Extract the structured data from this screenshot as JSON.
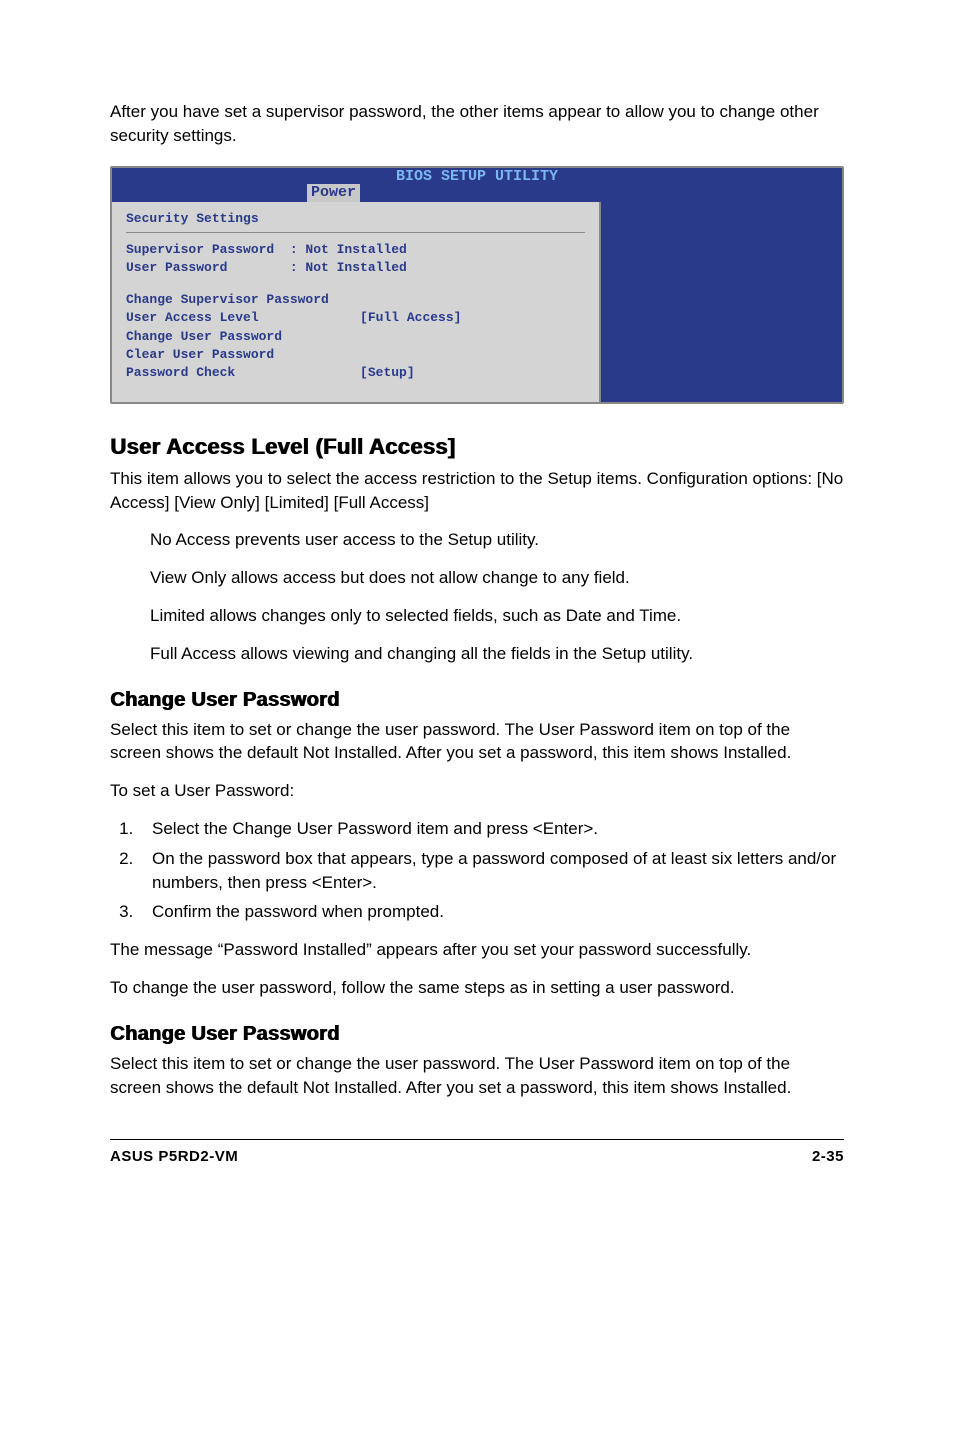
{
  "intro": "After you have set a supervisor password, the other items appear to allow you to change other security settings.",
  "bios": {
    "title": "BIOS SETUP UTILITY",
    "tab": "Power",
    "section_heading": "Security Settings",
    "line_supervisor": "Supervisor Password  : Not Installed",
    "line_user": "User Password        : Not Installed",
    "line_change_sup": "Change Supervisor Password",
    "line_access": "User Access Level             [Full Access]",
    "line_change_usr": "Change User Password",
    "line_clear": "Clear User Password",
    "line_check": "Password Check                [Setup]"
  },
  "ual": {
    "heading": "User Access Level (Full Access]",
    "p1": "This item allows you to select the access restriction to the Setup items. Configuration options: [No Access] [View Only] [Limited] [Full Access]",
    "no_access": "No Access prevents user access to the Setup utility.",
    "view_only": "View Only allows access but does not allow change to any field.",
    "limited": "Limited allows changes only to selected fields, such as Date and Time.",
    "full_access": "Full Access allows viewing and changing all the fields in the Setup utility."
  },
  "cup1": {
    "heading": "Change User Password",
    "p1": "Select this item to set or change the user password. The User Password item on top of the screen shows the default Not Installed. After you set a password, this item shows Installed.",
    "p2": "To set a User Password:",
    "steps": [
      "Select the Change User Password item and press <Enter>.",
      "On the password box that appears, type a password composed of at least six letters and/or numbers, then press <Enter>.",
      "Confirm the password when prompted."
    ],
    "p3": "The message “Password Installed” appears after you set your password successfully.",
    "p4": "To change the user password, follow the same steps as in setting a user password."
  },
  "cup2": {
    "heading": "Change User Password",
    "p1": "Select this item to set or change the user password. The User Password item on top of the screen shows the default Not Installed. After you set a password, this item shows Installed."
  },
  "footer": {
    "left": "ASUS P5RD2-VM",
    "right": "2-35"
  }
}
